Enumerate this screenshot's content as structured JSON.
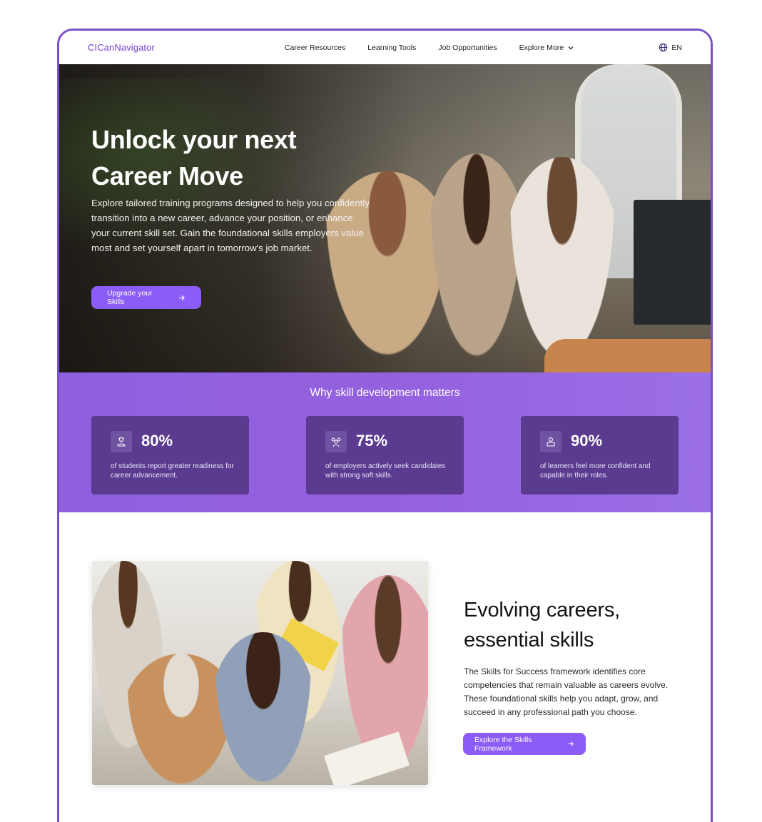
{
  "nav": {
    "logo": "CICanNavigator",
    "links": [
      "Career Resources",
      "Learning Tools",
      "Job Opportunities"
    ],
    "explore_label": "Explore More",
    "language": "EN"
  },
  "hero": {
    "title_line1": "Unlock your next",
    "title_line2": "Career Move",
    "description": "Explore tailored training programs designed to help you confidently transition into a new career, advance your position, or enhance your current skill set. Gain the foundational skills employers value most and set yourself apart in tomorrow's job market.",
    "cta_label": "Upgrade your Skills"
  },
  "stats": {
    "title": "Why skill development matters",
    "cards": [
      {
        "value": "80%",
        "text": "of students report greater readiness for career advancement.",
        "icon": "student-icon"
      },
      {
        "value": "75%",
        "text": "of employers actively seek candidates with strong soft skills.",
        "icon": "team-icon"
      },
      {
        "value": "90%",
        "text": "of learners feel more confident and capable in their roles.",
        "icon": "person-icon"
      }
    ]
  },
  "section": {
    "title_line1": "Evolving careers,",
    "title_line2": "essential skills",
    "description": "The Skills for Success framework identifies core competencies that remain valuable as careers evolve. These foundational skills help you adapt, grow, and succeed in any professional path you choose.",
    "cta_label": "Explore the Skills Framework"
  },
  "colors": {
    "accent": "#8b5cf6",
    "frame_border": "#7b4fc7",
    "stats_band": "#9461de",
    "stat_card": "#5a3b8f"
  }
}
